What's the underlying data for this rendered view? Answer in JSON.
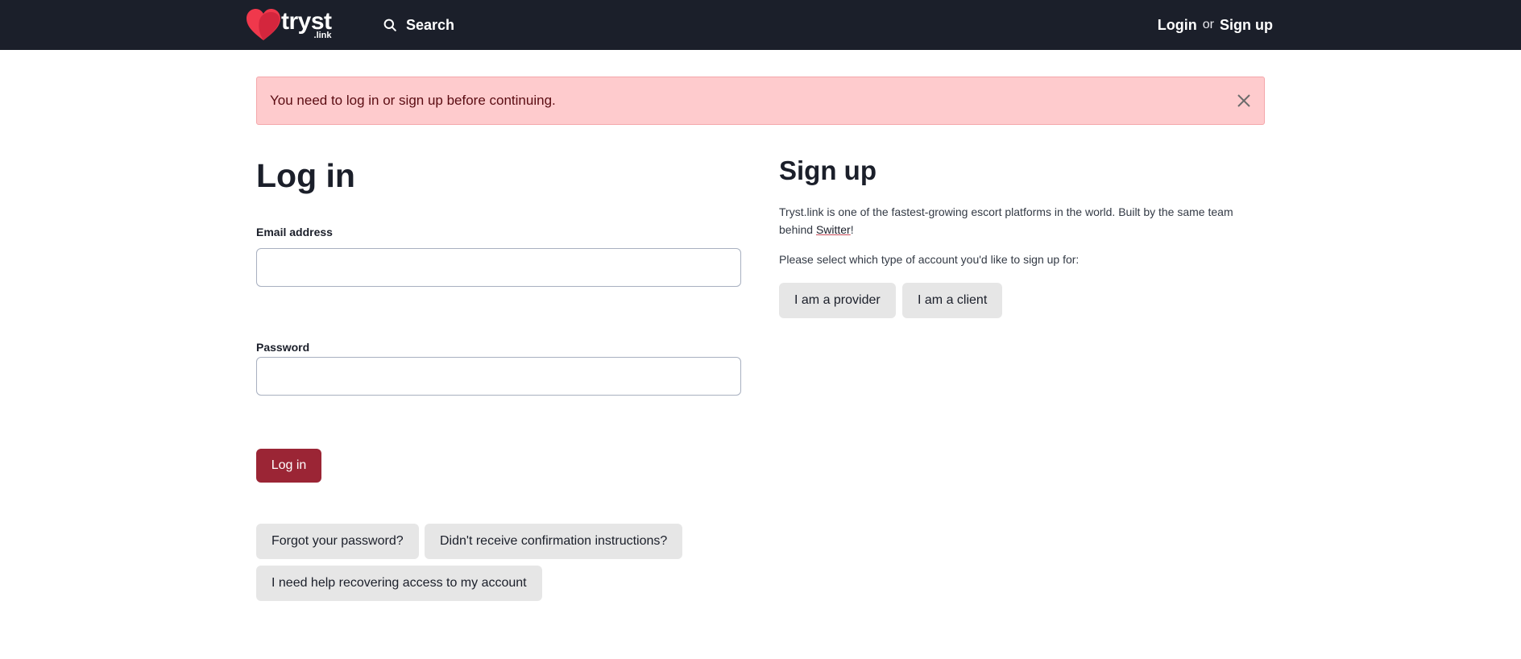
{
  "header": {
    "logo_word": "tryst",
    "logo_sub": ".link",
    "search_label": "Search",
    "login_label": "Login",
    "or_label": "or",
    "signup_label": "Sign up",
    "brand_color": "#f0384c",
    "bar_color": "#1b1f2a"
  },
  "alert": {
    "message": "You need to log in or sign up before continuing.",
    "close_icon": "close-icon"
  },
  "login": {
    "title": "Log in",
    "email_label": "Email address",
    "email_value": "",
    "password_label": "Password",
    "password_value": "",
    "submit_label": "Log in",
    "forgot_label": "Forgot your password?",
    "confirmation_label": "Didn't receive confirmation instructions?",
    "recover_label": "I need help recovering access to my account",
    "accent_color": "#9b2535"
  },
  "signup": {
    "title": "Sign up",
    "desc_before": "Tryst.link is one of the fastest-growing escort platforms in the world. Built by the same team behind ",
    "desc_link": "Switter",
    "desc_after": "!",
    "prompt": "Please select which type of account you'd like to sign up for:",
    "provider_label": "I am a provider",
    "client_label": "I am a client"
  }
}
